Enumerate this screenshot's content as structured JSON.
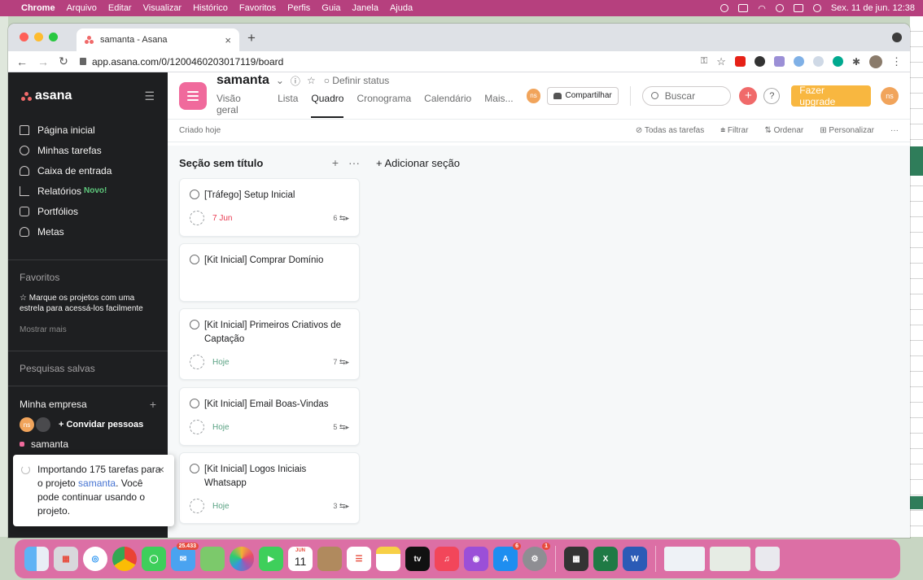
{
  "menubar": {
    "app": "Chrome",
    "items": [
      "Arquivo",
      "Editar",
      "Visualizar",
      "Histórico",
      "Favoritos",
      "Perfis",
      "Guia",
      "Janela",
      "Ajuda"
    ],
    "clock": "Sex. 11 de jun. 12:38"
  },
  "browser": {
    "tab_title": "samanta - Asana",
    "url": "app.asana.com/0/1200460203017119/board"
  },
  "sidebar": {
    "logo": "asana",
    "nav": [
      {
        "label": "Página inicial",
        "icon": "home-icon"
      },
      {
        "label": "Minhas tarefas",
        "icon": "check-circle-icon"
      },
      {
        "label": "Caixa de entrada",
        "icon": "bell-icon"
      },
      {
        "label": "Relatórios",
        "icon": "graph-icon",
        "badge": "Novo!"
      },
      {
        "label": "Portfólios",
        "icon": "portfolio-icon"
      },
      {
        "label": "Metas",
        "icon": "person-icon"
      }
    ],
    "favorites_heading": "Favoritos",
    "favorites_hint": "☆ Marque os projetos com uma estrela para acessá-los facilmente",
    "show_more": "Mostrar mais",
    "saved_searches": "Pesquisas salvas",
    "company": "Minha empresa",
    "avatar_initials": "ns",
    "invite": "+ Convidar pessoas",
    "project": "samanta"
  },
  "toast": {
    "text_before": "Importando 175 tarefas para o projeto ",
    "project_link": "samanta",
    "text_after": ". Você pode continuar usando o projeto."
  },
  "project": {
    "title": "samanta",
    "set_status": "○ Definir status",
    "tabs": [
      "Visão geral",
      "Lista",
      "Quadro",
      "Cronograma",
      "Calendário",
      "Mais..."
    ],
    "active_tab": "Quadro",
    "share": "Compartilhar",
    "search_placeholder": "Buscar",
    "upgrade": "Fazer upgrade",
    "user_initials": "ns",
    "created": "Criado hoje",
    "toolbar": {
      "all_tasks": "⊘ Todas as tarefas",
      "filter": "⩧ Filtrar",
      "sort": "⇅ Ordenar",
      "customize": "⊞ Personalizar",
      "more": "···"
    }
  },
  "board": {
    "section_title": "Seção sem título",
    "add_section": "+ Adicionar seção",
    "cards": [
      {
        "title": "[Tráfego] Setup Inicial",
        "due": "7 Jun",
        "due_color": "red",
        "subtasks": "6 ⇆▸"
      },
      {
        "title": "[Kit Inicial] Comprar Domínio",
        "due": "",
        "due_color": "",
        "subtasks": ""
      },
      {
        "title": "[Kit Inicial] Primeiros Criativos de Captação",
        "due": "Hoje",
        "due_color": "green",
        "subtasks": "7 ⇆▸"
      },
      {
        "title": "[Kit Inicial] Email Boas-Vindas",
        "due": "Hoje",
        "due_color": "green",
        "subtasks": "5 ⇆▸"
      },
      {
        "title": "[Kit Inicial] Logos Iniciais Whatsapp",
        "due": "Hoje",
        "due_color": "green",
        "subtasks": "3 ⇆▸"
      }
    ]
  },
  "dock": {
    "mail_badge": "25.433",
    "calendar_month": "JUN",
    "calendar_day": "11",
    "appstore_badge": "6",
    "settings_badge": "1"
  },
  "colors": {
    "menubar": "#b6407e",
    "sidebar": "#1e1f21",
    "project_icon": "#f06a9c",
    "upgrade": "#f8b740",
    "due_red": "#e8384f",
    "due_green": "#58a182"
  }
}
